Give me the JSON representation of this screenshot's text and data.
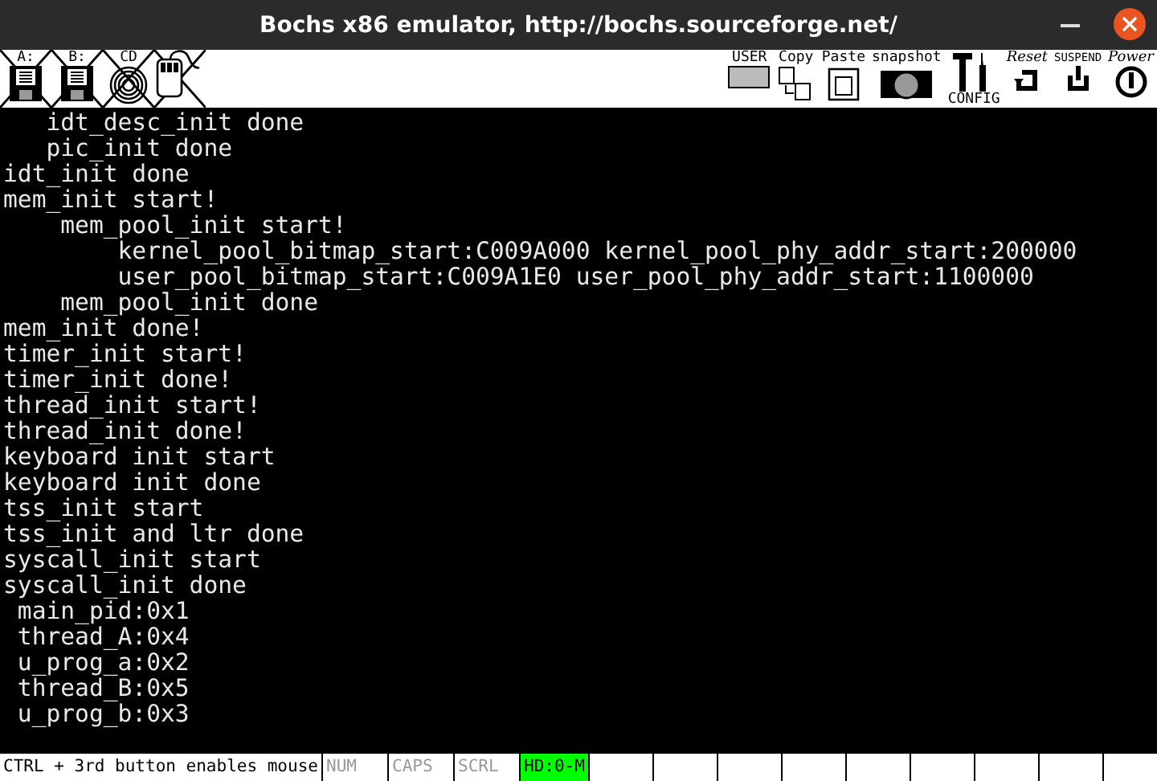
{
  "window": {
    "title": "Bochs x86 emulator, http://bochs.sourceforge.net/"
  },
  "toolbar_left": [
    {
      "kind": "floppy",
      "label": "A:",
      "crossed": true
    },
    {
      "kind": "floppy",
      "label": "B:",
      "crossed": true
    },
    {
      "kind": "cdrom",
      "label": "CD",
      "crossed": true
    },
    {
      "kind": "mouse",
      "crossed": true
    }
  ],
  "toolbar_right": [
    {
      "kind": "user",
      "label": "USER"
    },
    {
      "kind": "copy",
      "label": "Copy"
    },
    {
      "kind": "paste",
      "label": "Paste"
    },
    {
      "kind": "snapshot",
      "label": "snapshot"
    },
    {
      "kind": "config",
      "label": "CONFIG"
    },
    {
      "kind": "reset",
      "label": "Reset"
    },
    {
      "kind": "suspend",
      "label": "SUSPEND"
    },
    {
      "kind": "power",
      "label": "Power"
    }
  ],
  "console_lines": [
    "   idt_desc_init done",
    "   pic_init done",
    "idt_init done",
    "mem_init start!",
    "    mem_pool_init start!",
    "        kernel_pool_bitmap_start:C009A000 kernel_pool_phy_addr_start:200000",
    "        user_pool_bitmap_start:C009A1E0 user_pool_phy_addr_start:1100000",
    "    mem_pool_init done",
    "mem_init done!",
    "timer_init start!",
    "timer_init done!",
    "thread_init start!",
    "thread_init done!",
    "keyboard init start",
    "keyboard init done",
    "tss_init start",
    "tss_init and ltr done",
    "syscall_init start",
    "syscall_init done",
    " main_pid:0x1",
    " thread_A:0x4",
    " u_prog_a:0x2",
    " thread_B:0x5",
    " u_prog_b:0x3"
  ],
  "status_bar": {
    "message": "CTRL + 3rd button enables mouse",
    "indicators": [
      {
        "label": "NUM",
        "on": false
      },
      {
        "label": "CAPS",
        "on": false
      },
      {
        "label": "SCRL",
        "on": false
      },
      {
        "label": "HD:0-M",
        "on": true
      }
    ]
  }
}
